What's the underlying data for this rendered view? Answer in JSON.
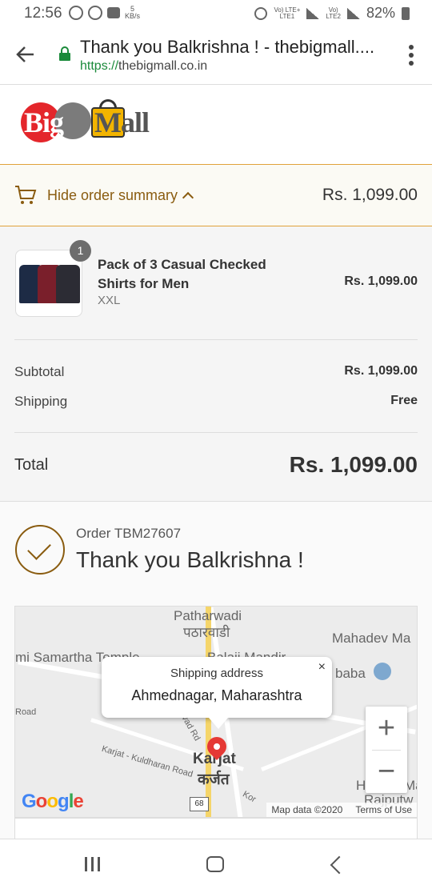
{
  "status_bar": {
    "time": "12:56",
    "net_speed": "5",
    "net_unit": "KB/s",
    "sim1_label": "Vo) LTE+",
    "sim1_sub": "LTE1",
    "sim2_label": "Vo)",
    "sim2_sub": "LTE2",
    "battery": "82%"
  },
  "browser": {
    "title": "Thank you Balkrishna ! - thebigmall....",
    "url_scheme": "https://",
    "url_host": "thebigmall.co.in"
  },
  "logo": {
    "big": "Big",
    "mall": "Mall"
  },
  "order_summary": {
    "toggle_label": "Hide order summary",
    "total": "Rs. 1,099.00",
    "item": {
      "quantity": "1",
      "name": "Pack of 3 Casual Checked Shirts for Men",
      "variant": "XXL",
      "price": "Rs. 1,099.00"
    },
    "subtotal_label": "Subtotal",
    "subtotal_value": "Rs. 1,099.00",
    "shipping_label": "Shipping",
    "shipping_value": "Free",
    "total_label": "Total",
    "total_value": "Rs. 1,099.00"
  },
  "confirmation": {
    "order_number": "Order TBM27607",
    "thanks": "Thank you Balkrishna !"
  },
  "map": {
    "popup_title": "Shipping address",
    "popup_value": "Ahmednagar, Maharashtra",
    "close": "×",
    "zoom_in": "+",
    "zoom_out": "−",
    "labels": {
      "patharwadi": "Patharwadi",
      "patharwadi_local": "पठारवाडी",
      "mahadev": "Mahadev Ma",
      "samartha": "mi Samartha Temple",
      "balaji": "Balaji Mandir",
      "baba": "baba",
      "road": "Road",
      "vad_rd": "vad Rd",
      "kuldharan": "Karjat - Kuldharan Road",
      "karjat": "Karjat",
      "karjat_local": "कर्जत",
      "hanu": "Hanu",
      "ma2": "Ma",
      "rajputw": "Rajputw",
      "kor": "Kor"
    },
    "route": "68",
    "google": "Google",
    "map_data": "Map data ©2020",
    "terms": "Terms of Use"
  },
  "colors": {
    "accent": "#8a5c10",
    "border_accent": "#e0a23a",
    "url_green": "#1a8a3a",
    "pin": "#e53935"
  }
}
